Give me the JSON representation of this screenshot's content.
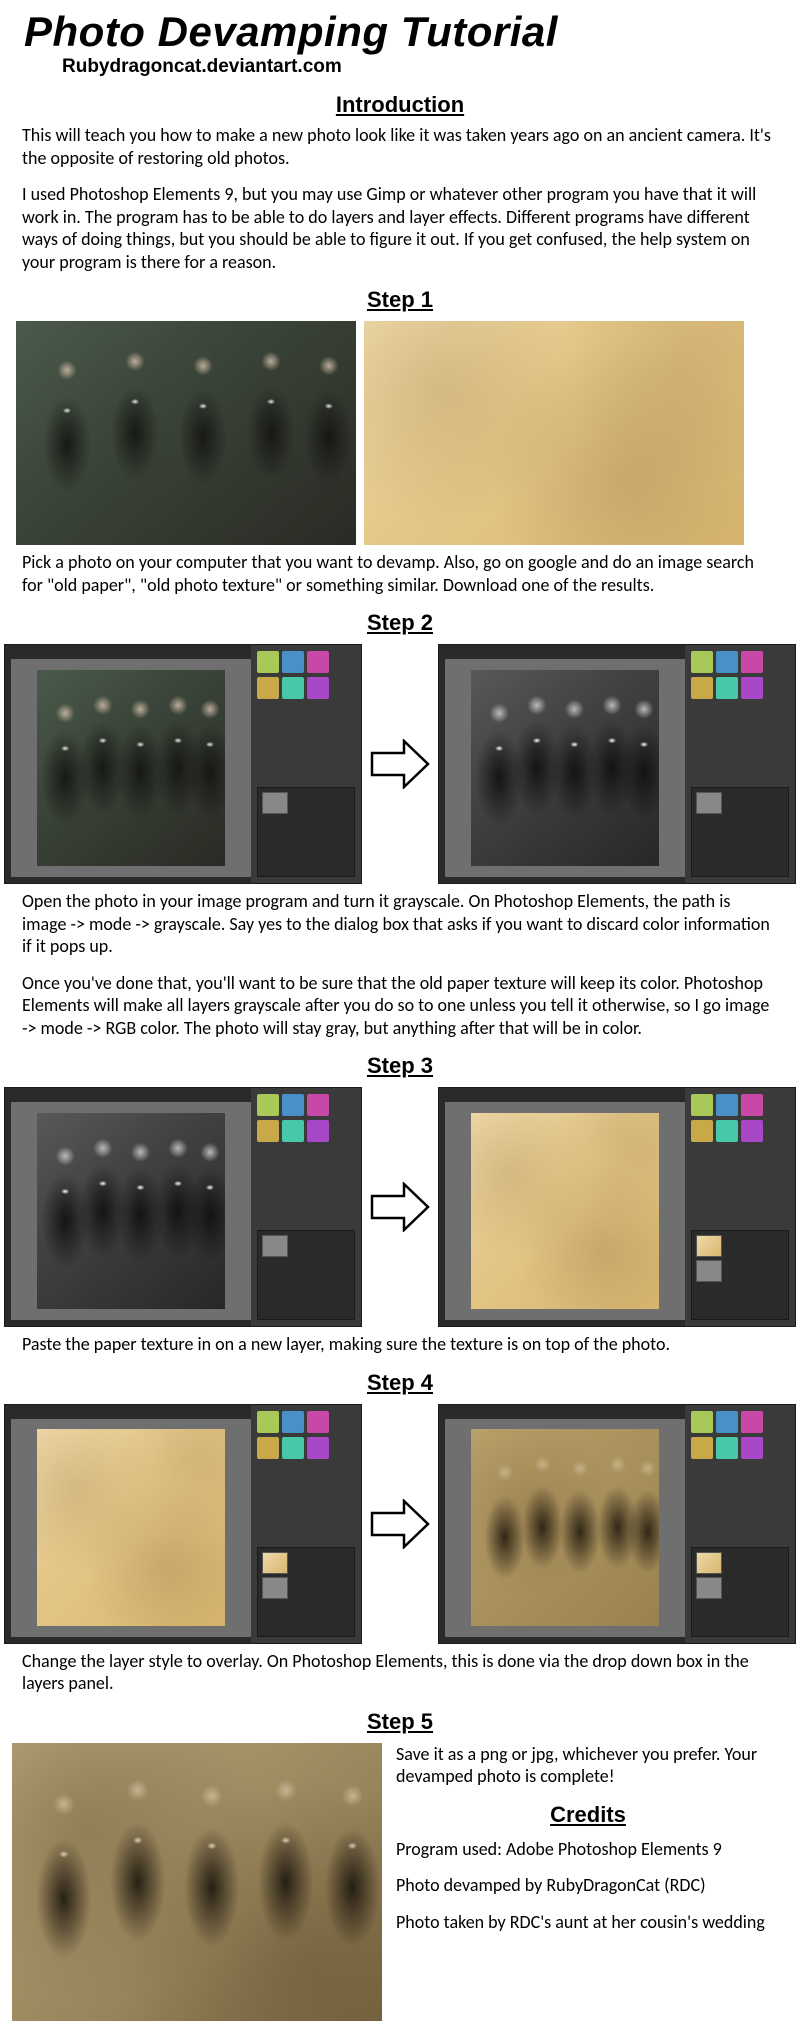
{
  "title": "Photo Devamping Tutorial",
  "subtitle": "Rubydragoncat.deviantart.com",
  "headings": {
    "intro": "Introduction",
    "s1": "Step 1",
    "s2": "Step 2",
    "s3": "Step 3",
    "s4": "Step 4",
    "s5": "Step 5",
    "credits": "Credits"
  },
  "intro": {
    "p1": "This will teach you how to make a new photo look like it was taken years ago on an ancient camera. It's the opposite of restoring old photos.",
    "p2": "I used Photoshop Elements 9, but you may use Gimp or whatever other program you have that it will work in. The program has to be able to do layers and layer effects. Different programs have different ways of doing things, but you should be able to figure it out. If you get confused, the help system on your program is there for a reason."
  },
  "step1": {
    "p1": "Pick a photo on your computer that you want to devamp. Also, go on google and do an image search for \"old paper\", \"old photo texture\" or something similar. Download one of the results."
  },
  "step2": {
    "p1": "Open the photo in your image program and turn it grayscale. On Photoshop Elements, the path is image -> mode -> grayscale. Say yes to the dialog box that asks if you want to discard color information if it pops up.",
    "p2": "Once you've done that, you'll want to be sure that the old paper texture will keep its color. Photoshop Elements will make all layers grayscale after you do so to one unless you tell it otherwise, so I go image -> mode -> RGB color. The photo will stay gray, but anything after that will be in color."
  },
  "step3": {
    "p1": "Paste the paper texture in on a new layer, making sure the texture is on top of the photo."
  },
  "step4": {
    "p1": "Change the layer style to overlay. On Photoshop Elements, this is done via the drop down box in the layers panel."
  },
  "step5": {
    "p1": "Save it as a png or jpg, whichever you prefer. Your devamped photo is complete!"
  },
  "credits": {
    "c1": "Program used: Adobe Photoshop Elements 9",
    "c2": "Photo devamped by RubyDragonCat (RDC)",
    "c3": "Photo taken by RDC's aunt at her cousin's wedding"
  }
}
